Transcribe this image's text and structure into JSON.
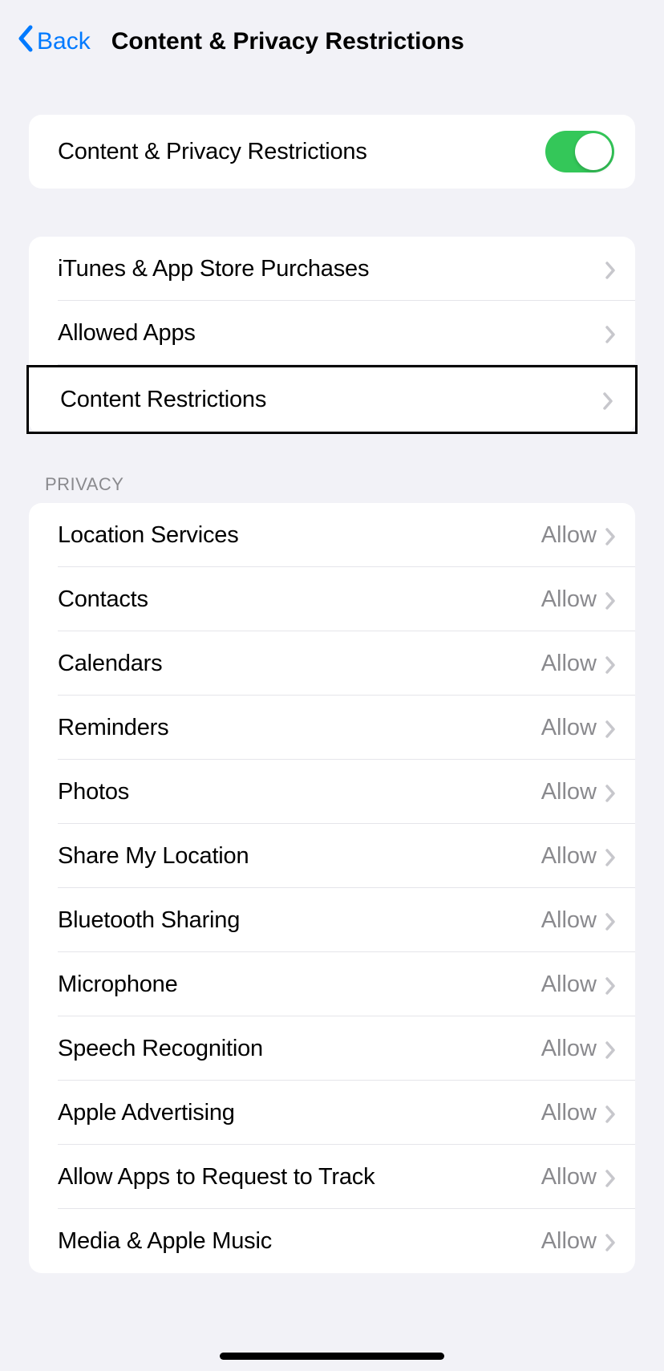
{
  "header": {
    "back_label": "Back",
    "title": "Content & Privacy Restrictions"
  },
  "toggle_section": {
    "label": "Content & Privacy Restrictions",
    "enabled": true
  },
  "nav_section": {
    "items": [
      {
        "label": "iTunes & App Store Purchases"
      },
      {
        "label": "Allowed Apps"
      },
      {
        "label": "Content Restrictions",
        "highlighted": true
      }
    ]
  },
  "privacy_section": {
    "header": "Privacy",
    "items": [
      {
        "label": "Location Services",
        "value": "Allow"
      },
      {
        "label": "Contacts",
        "value": "Allow"
      },
      {
        "label": "Calendars",
        "value": "Allow"
      },
      {
        "label": "Reminders",
        "value": "Allow"
      },
      {
        "label": "Photos",
        "value": "Allow"
      },
      {
        "label": "Share My Location",
        "value": "Allow"
      },
      {
        "label": "Bluetooth Sharing",
        "value": "Allow"
      },
      {
        "label": "Microphone",
        "value": "Allow"
      },
      {
        "label": "Speech Recognition",
        "value": "Allow"
      },
      {
        "label": "Apple Advertising",
        "value": "Allow"
      },
      {
        "label": "Allow Apps to Request to Track",
        "value": "Allow"
      },
      {
        "label": "Media & Apple Music",
        "value": "Allow"
      }
    ]
  }
}
